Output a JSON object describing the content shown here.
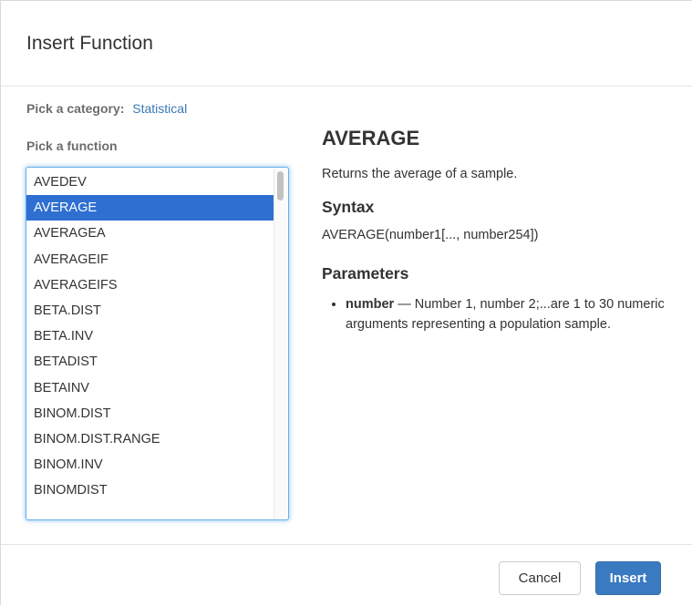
{
  "dialog": {
    "title": "Insert Function"
  },
  "category": {
    "label": "Pick a category:",
    "value": "Statistical"
  },
  "function_picker": {
    "label": "Pick a function",
    "selected": "AVERAGE",
    "items": [
      "AVEDEV",
      "AVERAGE",
      "AVERAGEA",
      "AVERAGEIF",
      "AVERAGEIFS",
      "BETA.DIST",
      "BETA.INV",
      "BETADIST",
      "BETAINV",
      "BINOM.DIST",
      "BINOM.DIST.RANGE",
      "BINOM.INV",
      "BINOMDIST"
    ]
  },
  "details": {
    "name": "AVERAGE",
    "description": "Returns the average of a sample.",
    "syntax_heading": "Syntax",
    "syntax": "AVERAGE(number1[..., number254])",
    "parameters_heading": "Parameters",
    "parameters": [
      {
        "name": "number",
        "separator": " — ",
        "description": "Number 1, number 2;...are 1 to 30 numeric arguments representing a population sample."
      }
    ]
  },
  "buttons": {
    "cancel": "Cancel",
    "insert": "Insert"
  },
  "colors": {
    "selection": "#2f6fd1",
    "link": "#3a78b5",
    "primary_button": "#3a7ac1",
    "focus_ring": "#66afe9"
  }
}
